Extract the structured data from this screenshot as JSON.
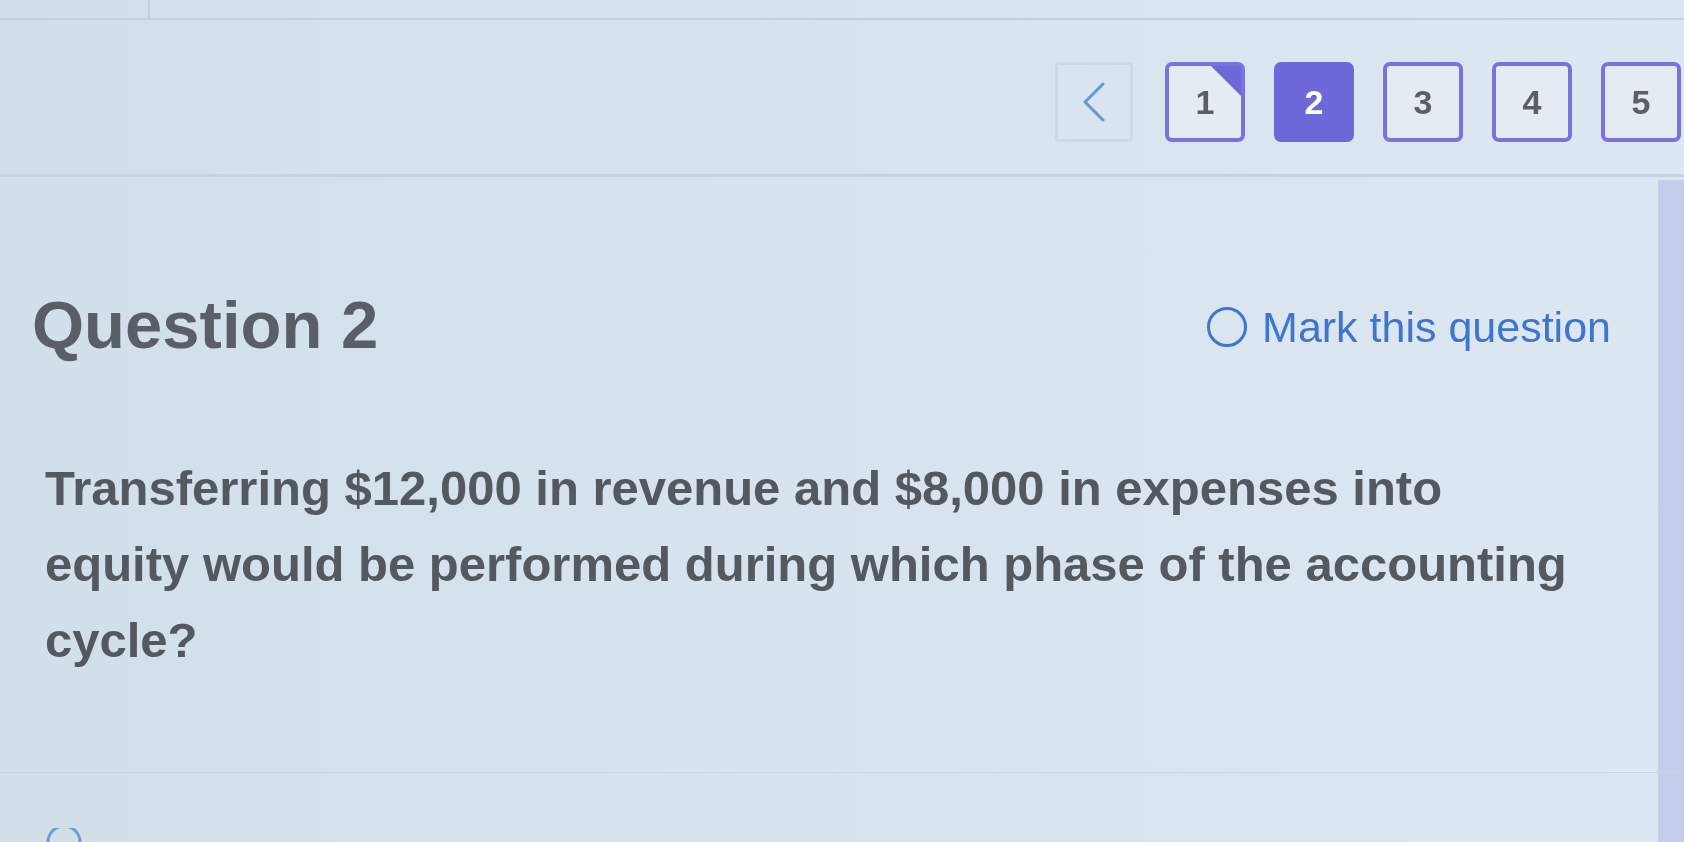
{
  "pagination": {
    "pages": [
      {
        "label": "1",
        "selected": false,
        "marked": true
      },
      {
        "label": "2",
        "selected": true,
        "marked": false
      },
      {
        "label": "3",
        "selected": false,
        "marked": false
      },
      {
        "label": "4",
        "selected": false,
        "marked": false
      },
      {
        "label": "5",
        "selected": false,
        "marked": false
      }
    ]
  },
  "question": {
    "title": "Question 2",
    "mark": {
      "label": "Mark this question",
      "checked": false
    },
    "text": "Transferring $12,000 in revenue and $8,000 in expenses into equity would be performed during which phase of the accounting cycle?"
  }
}
